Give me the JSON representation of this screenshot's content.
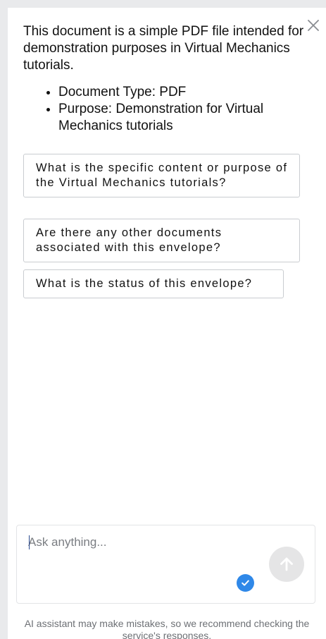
{
  "summary": {
    "intro": "This document is a simple PDF file intended for demonstration purposes in Virtual Mechanics tutorials.",
    "bullets": [
      "Document Type: PDF",
      "Purpose: Demonstration for Virtual Mechanics tutorials"
    ]
  },
  "suggestions": [
    "What is the specific content or purpose of the Virtual Mechanics tutorials?",
    "Are there any other documents associated with this envelope?",
    "What is the status of this envelope?"
  ],
  "chat": {
    "placeholder": "Ask anything..."
  },
  "icons": {
    "close": "close-icon",
    "send": "arrow-up-icon",
    "check": "checkmark-icon"
  },
  "colors": {
    "accent": "#2f88e8",
    "send_button_disabled": "#e5e5e6"
  },
  "disclaimer": "AI assistant may make mistakes, so we recommend checking the service's responses."
}
